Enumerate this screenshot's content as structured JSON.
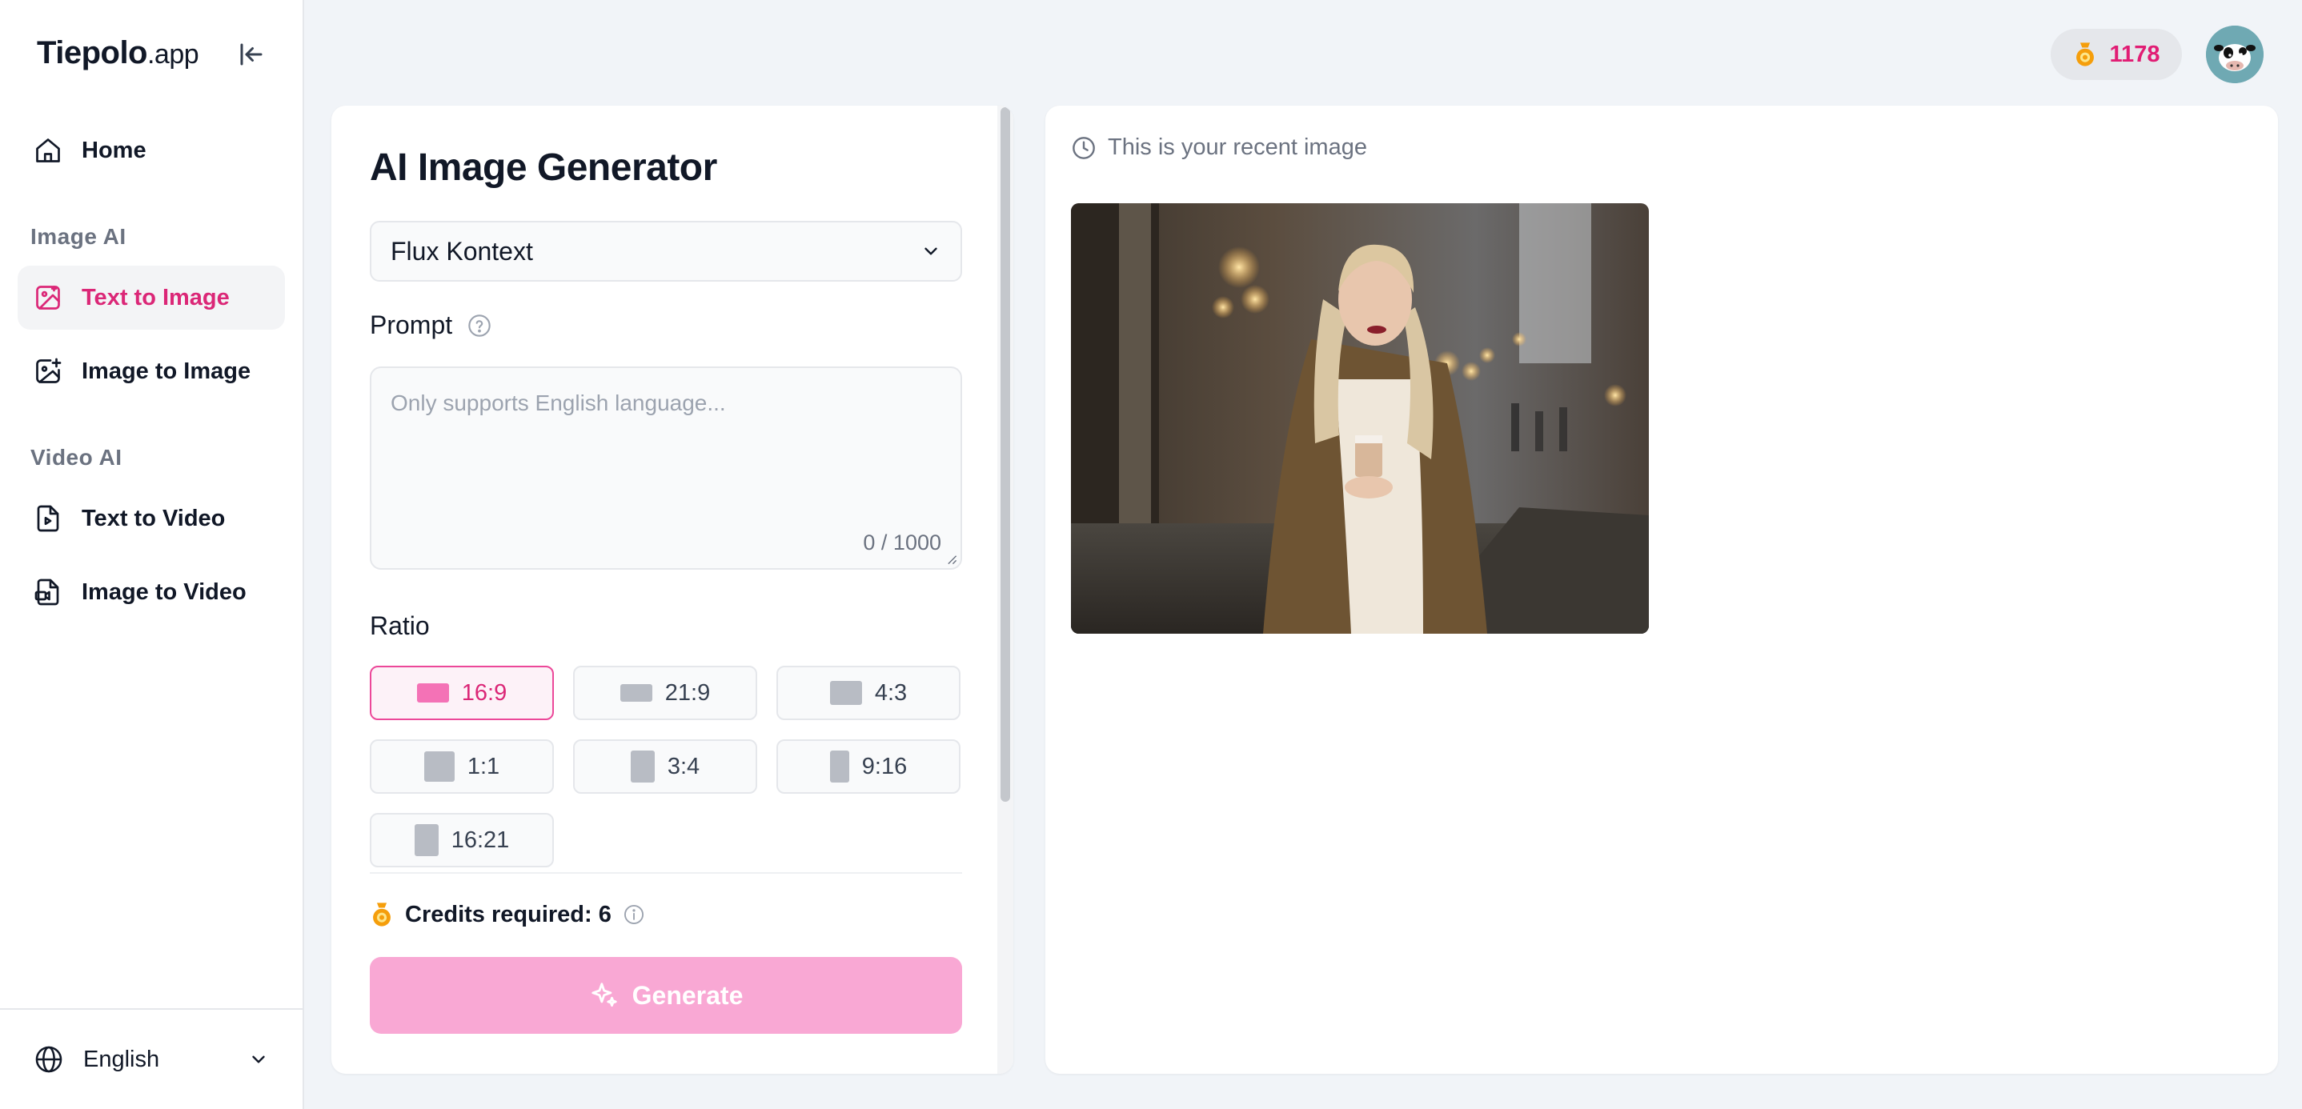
{
  "brand": {
    "name_bold": "Tiepolo",
    "name_suffix": ".app"
  },
  "sidebar": {
    "home": "Home",
    "sections": [
      {
        "label": "Image AI",
        "items": [
          "Text to Image",
          "Image to Image"
        ]
      },
      {
        "label": "Video AI",
        "items": [
          "Text to Video",
          "Image to Video"
        ]
      }
    ],
    "active_item": "Text to Image",
    "language": "English"
  },
  "header": {
    "credits": "1178"
  },
  "generator": {
    "title": "AI Image Generator",
    "model": "Flux Kontext",
    "prompt_label": "Prompt",
    "prompt_placeholder": "Only supports English language...",
    "counter": "0 / 1000",
    "ratio_label": "Ratio",
    "ratios": [
      "16:9",
      "21:9",
      "4:3",
      "1:1",
      "3:4",
      "9:16",
      "16:21"
    ],
    "selected_ratio": "16:9",
    "credits_required": "Credits required: 6",
    "generate_label": "Generate"
  },
  "preview": {
    "recent_label": "This is your recent image"
  },
  "colors": {
    "accent": "#db2777",
    "generate_bg": "#f9a8d4",
    "coin": "#f59e0b"
  }
}
